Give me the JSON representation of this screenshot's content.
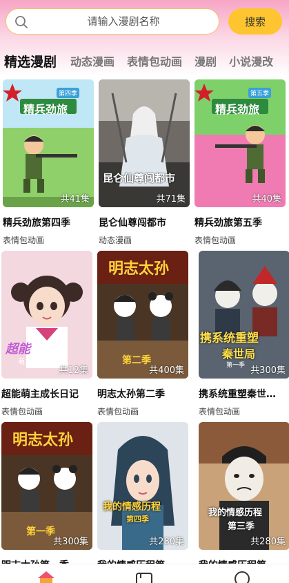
{
  "search": {
    "placeholder": "请输入漫剧名称",
    "button_label": "搜索"
  },
  "tabs": [
    {
      "label": "精选漫剧",
      "active": true
    },
    {
      "label": "动态漫画",
      "active": false
    },
    {
      "label": "表情包动画",
      "active": false
    },
    {
      "label": "漫剧",
      "active": false
    },
    {
      "label": "小说漫改",
      "active": false
    }
  ],
  "cards": [
    {
      "title": "精兵劲旅第四季",
      "category": "表情包动画",
      "episodes": "共41集",
      "cover_text": "精兵劲旅",
      "season_badge": "第四季",
      "theme": "soldier"
    },
    {
      "title": "昆仑仙尊闯都市",
      "category": "动态漫画",
      "episodes": "共71集",
      "cover_text": "昆仑仙尊闯都市",
      "theme": "immortal"
    },
    {
      "title": "精兵劲旅第五季",
      "category": "表情包动画",
      "episodes": "共40集",
      "cover_text": "精兵劲旅",
      "season_badge": "第五季",
      "theme": "soldier"
    },
    {
      "title": "超能萌主成长日记",
      "category": "表情包动画",
      "episodes": "共12集",
      "cover_text": "超能",
      "cover_subtext": "萌主成长日记",
      "theme": "girl"
    },
    {
      "title": "明志太孙第二季",
      "category": "表情包动画",
      "episodes": "共400集",
      "cover_text": "明志太孙",
      "season_badge": "第二季",
      "theme": "panda"
    },
    {
      "title": "携系统重塑秦世…",
      "category": "表情包动画",
      "episodes": "共300集",
      "cover_text": "携系统重塑",
      "cover_subtext": "秦世局",
      "season_badge": "第一季",
      "theme": "warriors"
    },
    {
      "title": "明志太孙第一季",
      "category": "",
      "episodes": "共300集",
      "cover_text": "明志太孙",
      "season_badge": "第一季",
      "theme": "panda"
    },
    {
      "title": "我的情感历程第…",
      "category": "",
      "episodes": "共280集",
      "cover_text": "我的情感历程",
      "season_badge": "第四季",
      "theme": "woman"
    },
    {
      "title": "我的情感历程第…",
      "category": "",
      "episodes": "共280集",
      "cover_text": "我的情感历程",
      "season_badge": "第三季",
      "theme": "man"
    }
  ],
  "nav": [
    {
      "icon": "home-icon",
      "active": true
    },
    {
      "icon": "wallet-icon",
      "active": false
    },
    {
      "icon": "profile-icon",
      "active": false
    }
  ],
  "colors": {
    "accent": "#ffc530",
    "active_nav": "#f0506e",
    "header_pink": "#f7a5c5"
  }
}
